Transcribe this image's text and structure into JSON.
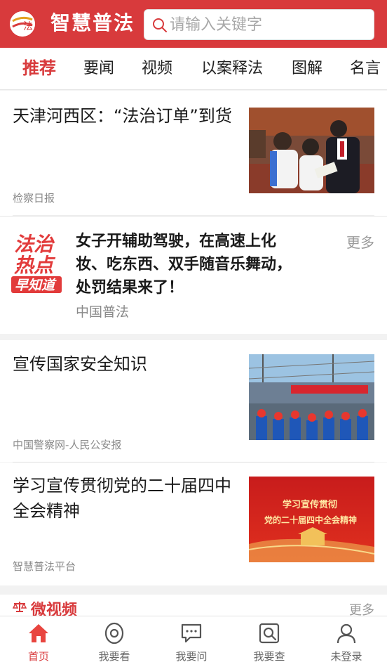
{
  "header": {
    "logo_mark": "法",
    "title": "智慧普法",
    "search_placeholder": "请输入关键字"
  },
  "tabs": [
    {
      "label": "推荐",
      "active": true
    },
    {
      "label": "要闻",
      "active": false
    },
    {
      "label": "视频",
      "active": false
    },
    {
      "label": "以案释法",
      "active": false
    },
    {
      "label": "图解",
      "active": false
    },
    {
      "label": "名言",
      "active": false
    }
  ],
  "feed": {
    "items": [
      {
        "title": "天津河西区：“法治订单”到货",
        "source": "检察日报",
        "thumb_icon": "students-photo"
      },
      {
        "title": "宣传国家安全知识",
        "source": "中国警察网-人民公安报",
        "thumb_icon": "ship-workers-photo"
      },
      {
        "title": "学习宣传贯彻党的二十届四中全会精神",
        "source": "智慧普法平台",
        "thumb_icon": "red-banner-photo",
        "thumb_text_1": "学习宣传贯彻",
        "thumb_text_2": "党的二十届四中全会精神"
      }
    ],
    "hot": {
      "badge_lines": [
        "法治",
        "热点",
        "早知道"
      ],
      "title": "女子开辅助驾驶，在高速上化妆、吃东西、双手随音乐舞动，处罚结果来了！",
      "source": "中国普法",
      "more": "更多"
    }
  },
  "video_section": {
    "title": "微视频",
    "more": "更多"
  },
  "bottom_nav": [
    {
      "label": "首页",
      "icon": "home-icon",
      "active": true
    },
    {
      "label": "我要看",
      "icon": "eye-icon",
      "active": false
    },
    {
      "label": "我要问",
      "icon": "chat-icon",
      "active": false
    },
    {
      "label": "我要查",
      "icon": "search-doc-icon",
      "active": false
    },
    {
      "label": "未登录",
      "icon": "user-icon",
      "active": false
    }
  ],
  "colors": {
    "brand": "#d83a3c",
    "text": "#1a1a1a",
    "muted": "#8a8a8a"
  }
}
